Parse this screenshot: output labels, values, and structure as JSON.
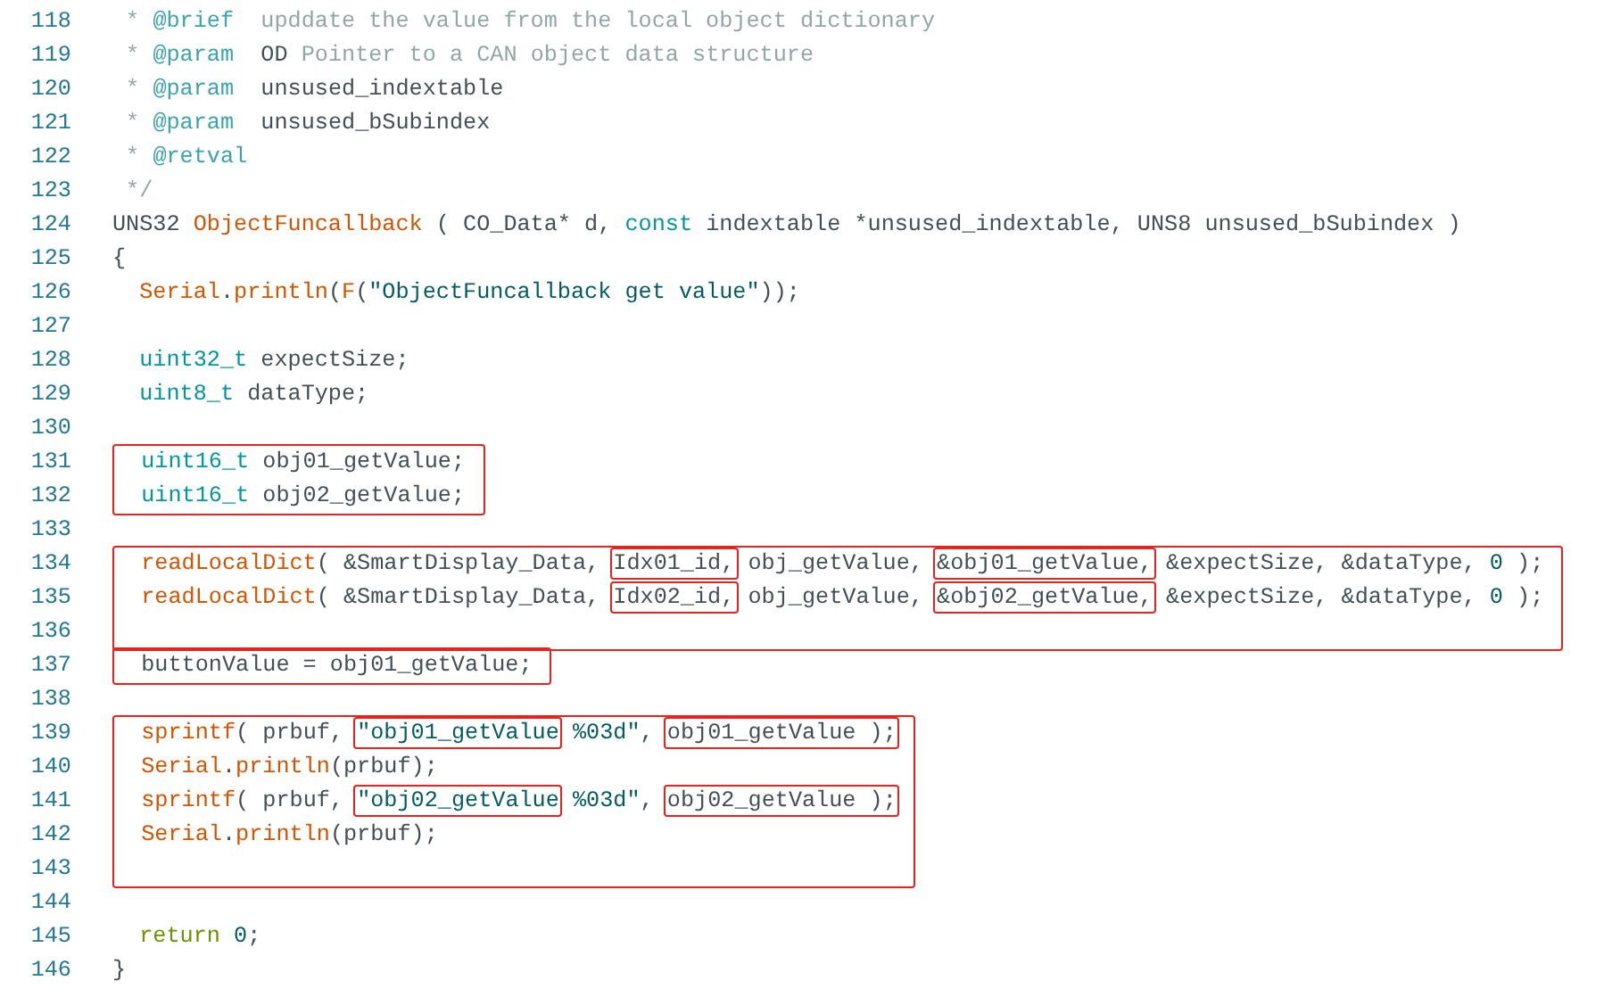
{
  "code": [
    {
      "kind": "line",
      "number": "118",
      "tokens": [
        {
          "text": " * ",
          "kind": "comment"
        },
        {
          "text": "@brief",
          "kind": "tag"
        },
        {
          "text": "  upddate the value from the local object dictionary",
          "kind": "comment"
        }
      ]
    },
    {
      "kind": "line",
      "number": "119",
      "tokens": [
        {
          "text": " * ",
          "kind": "comment"
        },
        {
          "text": "@param",
          "kind": "tag"
        },
        {
          "text": "  OD",
          "kind": "plain"
        },
        {
          "text": " Pointer to a CAN object data structure",
          "kind": "comment"
        }
      ]
    },
    {
      "kind": "line",
      "number": "120",
      "tokens": [
        {
          "text": " * ",
          "kind": "comment"
        },
        {
          "text": "@param",
          "kind": "tag"
        },
        {
          "text": "  unsused_indextable",
          "kind": "plain"
        }
      ]
    },
    {
      "kind": "line",
      "number": "121",
      "tokens": [
        {
          "text": " * ",
          "kind": "comment"
        },
        {
          "text": "@param",
          "kind": "tag"
        },
        {
          "text": "  unsused_bSubindex",
          "kind": "plain"
        }
      ]
    },
    {
      "kind": "line",
      "number": "122",
      "tokens": [
        {
          "text": " * ",
          "kind": "comment"
        },
        {
          "text": "@retval",
          "kind": "tag"
        }
      ]
    },
    {
      "kind": "line",
      "number": "123",
      "tokens": [
        {
          "text": " */",
          "kind": "comment"
        }
      ]
    },
    {
      "kind": "line",
      "number": "124",
      "tokens": [
        {
          "text": "UNS32 ",
          "kind": "plain"
        },
        {
          "text": "ObjectFuncallback",
          "kind": "func"
        },
        {
          "text": " ( CO_Data* d, ",
          "kind": "plain"
        },
        {
          "text": "const",
          "kind": "keyword"
        },
        {
          "text": " indextable *unsused_indextable, UNS8 unsused_bSubindex )",
          "kind": "plain"
        }
      ]
    },
    {
      "kind": "line",
      "number": "125",
      "tokens": [
        {
          "text": "{",
          "kind": "plain"
        }
      ]
    },
    {
      "kind": "line",
      "number": "126",
      "tokens": [
        {
          "text": "  Serial",
          "kind": "func"
        },
        {
          "text": ".",
          "kind": "plain"
        },
        {
          "text": "println",
          "kind": "func"
        },
        {
          "text": "(",
          "kind": "plain"
        },
        {
          "text": "F",
          "kind": "func"
        },
        {
          "text": "(",
          "kind": "plain"
        },
        {
          "text": "\"ObjectFuncallback get value\"",
          "kind": "string"
        },
        {
          "text": "));",
          "kind": "plain"
        }
      ]
    },
    {
      "kind": "line",
      "number": "127"
    },
    {
      "kind": "line",
      "number": "128",
      "tokens": [
        {
          "text": "  uint32_t",
          "kind": "type"
        },
        {
          "text": " expectSize;",
          "kind": "plain"
        }
      ]
    },
    {
      "kind": "line",
      "number": "129",
      "tokens": [
        {
          "text": "  uint8_t",
          "kind": "type"
        },
        {
          "text": " dataType;",
          "kind": "plain"
        }
      ]
    },
    {
      "kind": "line",
      "number": "130"
    },
    {
      "kind": "block",
      "lines": [
        {
          "number": "131",
          "tokens": [
            {
              "text": "  uint16_t",
              "kind": "type"
            },
            {
              "text": " obj01_getValue;",
              "kind": "plain"
            }
          ]
        },
        {
          "number": "132",
          "tokens": [
            {
              "text": "  uint16_t",
              "kind": "type"
            },
            {
              "text": " obj02_getValue;",
              "kind": "plain"
            }
          ]
        }
      ]
    },
    {
      "kind": "line",
      "number": "133"
    },
    {
      "kind": "block",
      "lines": [
        {
          "number": "134",
          "tokens": [
            {
              "text": "  readLocalDict",
              "kind": "func"
            },
            {
              "text": "( &SmartDisplay_Data, ",
              "kind": "plain"
            },
            {
              "text": "Idx01_id,",
              "kind": "plain",
              "boxed": true
            },
            {
              "text": " obj_getValue, ",
              "kind": "plain"
            },
            {
              "text": "&obj01_getValue,",
              "kind": "plain",
              "boxed": true
            },
            {
              "text": " &expectSize, &dataType, ",
              "kind": "plain"
            },
            {
              "text": "0",
              "kind": "number"
            },
            {
              "text": " );",
              "kind": "plain"
            }
          ]
        },
        {
          "number": "135",
          "tokens": [
            {
              "text": "  readLocalDict",
              "kind": "func"
            },
            {
              "text": "( &SmartDisplay_Data, ",
              "kind": "plain"
            },
            {
              "text": "Idx02_id,",
              "kind": "plain",
              "boxed": true
            },
            {
              "text": " obj_getValue, ",
              "kind": "plain"
            },
            {
              "text": "&obj02_getValue,",
              "kind": "plain",
              "boxed": true
            },
            {
              "text": " &expectSize, &dataType, ",
              "kind": "plain"
            },
            {
              "text": "0",
              "kind": "number"
            },
            {
              "text": " );",
              "kind": "plain"
            }
          ]
        },
        {
          "number": "136"
        }
      ]
    },
    {
      "kind": "block",
      "lines": [
        {
          "number": "137",
          "tokens": [
            {
              "text": "  buttonValue = obj01_getValue;",
              "kind": "plain"
            }
          ]
        }
      ]
    },
    {
      "kind": "line",
      "number": "138"
    },
    {
      "kind": "block",
      "lines": [
        {
          "number": "139",
          "tokens": [
            {
              "text": "  sprintf",
              "kind": "func"
            },
            {
              "text": "( prbuf, ",
              "kind": "plain"
            },
            {
              "text": "\"obj01_getValue",
              "kind": "string",
              "boxed": true
            },
            {
              "text": " %03d\"",
              "kind": "string"
            },
            {
              "text": ", ",
              "kind": "plain"
            },
            {
              "text": "obj01_getValue );",
              "kind": "plain",
              "boxed": true
            }
          ]
        },
        {
          "number": "140",
          "tokens": [
            {
              "text": "  Serial",
              "kind": "func"
            },
            {
              "text": ".",
              "kind": "plain"
            },
            {
              "text": "println",
              "kind": "func"
            },
            {
              "text": "(prbuf);",
              "kind": "plain"
            }
          ]
        },
        {
          "number": "141",
          "tokens": [
            {
              "text": "  sprintf",
              "kind": "func"
            },
            {
              "text": "( prbuf, ",
              "kind": "plain"
            },
            {
              "text": "\"obj02_getValue",
              "kind": "string",
              "boxed": true
            },
            {
              "text": " %03d\"",
              "kind": "string"
            },
            {
              "text": ", ",
              "kind": "plain"
            },
            {
              "text": "obj02_getValue );",
              "kind": "plain",
              "boxed": true
            }
          ]
        },
        {
          "number": "142",
          "tokens": [
            {
              "text": "  Serial",
              "kind": "func"
            },
            {
              "text": ".",
              "kind": "plain"
            },
            {
              "text": "println",
              "kind": "func"
            },
            {
              "text": "(prbuf);",
              "kind": "plain"
            }
          ]
        },
        {
          "number": "143"
        }
      ]
    },
    {
      "kind": "line",
      "number": "144"
    },
    {
      "kind": "line",
      "number": "145",
      "tokens": [
        {
          "text": "  return ",
          "kind": "ret"
        },
        {
          "text": "0",
          "kind": "number"
        },
        {
          "text": ";",
          "kind": "plain"
        }
      ]
    },
    {
      "kind": "line",
      "number": "146",
      "tokens": [
        {
          "text": "}",
          "kind": "plain"
        }
      ]
    }
  ]
}
